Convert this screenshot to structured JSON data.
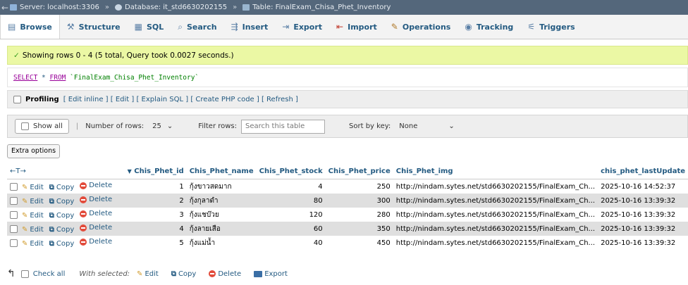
{
  "breadcrumb": {
    "server": "Server: localhost:3306",
    "database": "Database: it_std6630202155",
    "table": "Table: FinalExam_Chisa_Phet_Inventory"
  },
  "tabs": [
    {
      "label": "Browse",
      "icon": "browse-icon"
    },
    {
      "label": "Structure",
      "icon": "structure-icon"
    },
    {
      "label": "SQL",
      "icon": "sql-icon"
    },
    {
      "label": "Search",
      "icon": "search-icon"
    },
    {
      "label": "Insert",
      "icon": "insert-icon"
    },
    {
      "label": "Export",
      "icon": "export-icon"
    },
    {
      "label": "Import",
      "icon": "import-icon"
    },
    {
      "label": "Operations",
      "icon": "operations-icon"
    },
    {
      "label": "Tracking",
      "icon": "tracking-icon"
    },
    {
      "label": "Triggers",
      "icon": "triggers-icon"
    }
  ],
  "success_message": "Showing rows 0 - 4 (5 total, Query took 0.0027 seconds.)",
  "sql": {
    "select": "SELECT",
    "rest": " * ",
    "from": "FROM",
    "table": " `FinalExam_Chisa_Phet_Inventory`"
  },
  "profiling": {
    "label": "Profiling",
    "links": "[ Edit inline ] [ Edit ] [ Explain SQL ] [ Create PHP code ] [ Refresh ]"
  },
  "nav": {
    "show_all": "Show all",
    "rows_label": "Number of rows:",
    "rows_value": "25",
    "filter_label": "Filter rows:",
    "filter_placeholder": "Search this table",
    "sort_label": "Sort by key:",
    "sort_value": "None"
  },
  "extra_options": "Extra options",
  "columns": [
    "Chis_Phet_id",
    "Chis_Phet_name",
    "Chis_Phet_stock",
    "Chis_Phet_price",
    "Chis_Phet_img",
    "chis_phet_lastUpdate"
  ],
  "sort_arrows": "←T→",
  "row_actions": {
    "edit": "Edit",
    "copy": "Copy",
    "delete": "Delete"
  },
  "rows": [
    {
      "id": "1",
      "name": "กุ้งขาวสดมาก",
      "stock": "4",
      "price": "250",
      "img": "http://nindam.sytes.net/std6630202155/FinalExam_Ch...",
      "updated": "2025-10-16 14:52:37"
    },
    {
      "id": "2",
      "name": "กุ้งกุลาดำ",
      "stock": "80",
      "price": "300",
      "img": "http://nindam.sytes.net/std6630202155/FinalExam_Ch...",
      "updated": "2025-10-16 13:39:32"
    },
    {
      "id": "3",
      "name": "กุ้งแชบ๊วย",
      "stock": "120",
      "price": "280",
      "img": "http://nindam.sytes.net/std6630202155/FinalExam_Ch...",
      "updated": "2025-10-16 13:39:32"
    },
    {
      "id": "4",
      "name": "กุ้งลายเสือ",
      "stock": "60",
      "price": "350",
      "img": "http://nindam.sytes.net/std6630202155/FinalExam_Ch...",
      "updated": "2025-10-16 13:39:32"
    },
    {
      "id": "5",
      "name": "กุ้งแม่น้ำ",
      "stock": "40",
      "price": "450",
      "img": "http://nindam.sytes.net/std6630202155/FinalExam_Ch...",
      "updated": "2025-10-16 13:39:32"
    }
  ],
  "bottom": {
    "check_all": "Check all",
    "with_selected": "With selected:",
    "edit": "Edit",
    "copy": "Copy",
    "delete": "Delete",
    "export": "Export"
  }
}
